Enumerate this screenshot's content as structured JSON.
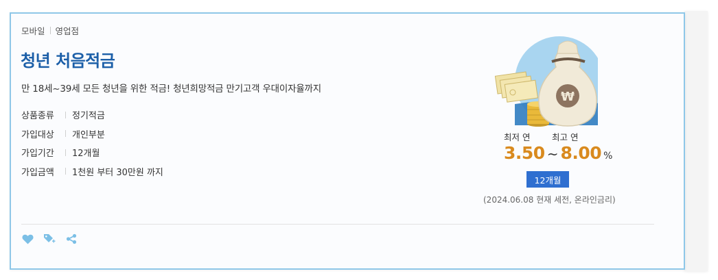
{
  "product": {
    "channels": [
      "모바일",
      "영업점"
    ],
    "title": "청년 처음적금",
    "description": "만 18세~39세 모든 청년을 위한 적금! 청년희망적금 만기고객 우대이자율까지",
    "info": [
      {
        "label": "상품종류",
        "value": "정기적금"
      },
      {
        "label": "가입대상",
        "value": "개인부분"
      },
      {
        "label": "가입기간",
        "value": "12개월"
      },
      {
        "label": "가입금액",
        "value": "1천원 부터 30만원 까지"
      }
    ]
  },
  "rate": {
    "min_label": "최저 연",
    "max_label": "최고 연",
    "min_value": "3.50",
    "max_value": "8.00",
    "separator": "~",
    "unit": "%",
    "period": "12개월",
    "note": "(2024.06.08 현재 세전, 온라인금리)"
  },
  "actions": [
    {
      "name": "heart-icon",
      "color": "#7bbfe6"
    },
    {
      "name": "tag-add-icon",
      "color": "#7bbfe6"
    },
    {
      "name": "share-icon",
      "color": "#7bbfe6"
    }
  ],
  "colors": {
    "title": "#1c5fa8",
    "rate": "#d98a1e",
    "badge": "#2f6fd0",
    "card_border": "#8ec7e8"
  }
}
